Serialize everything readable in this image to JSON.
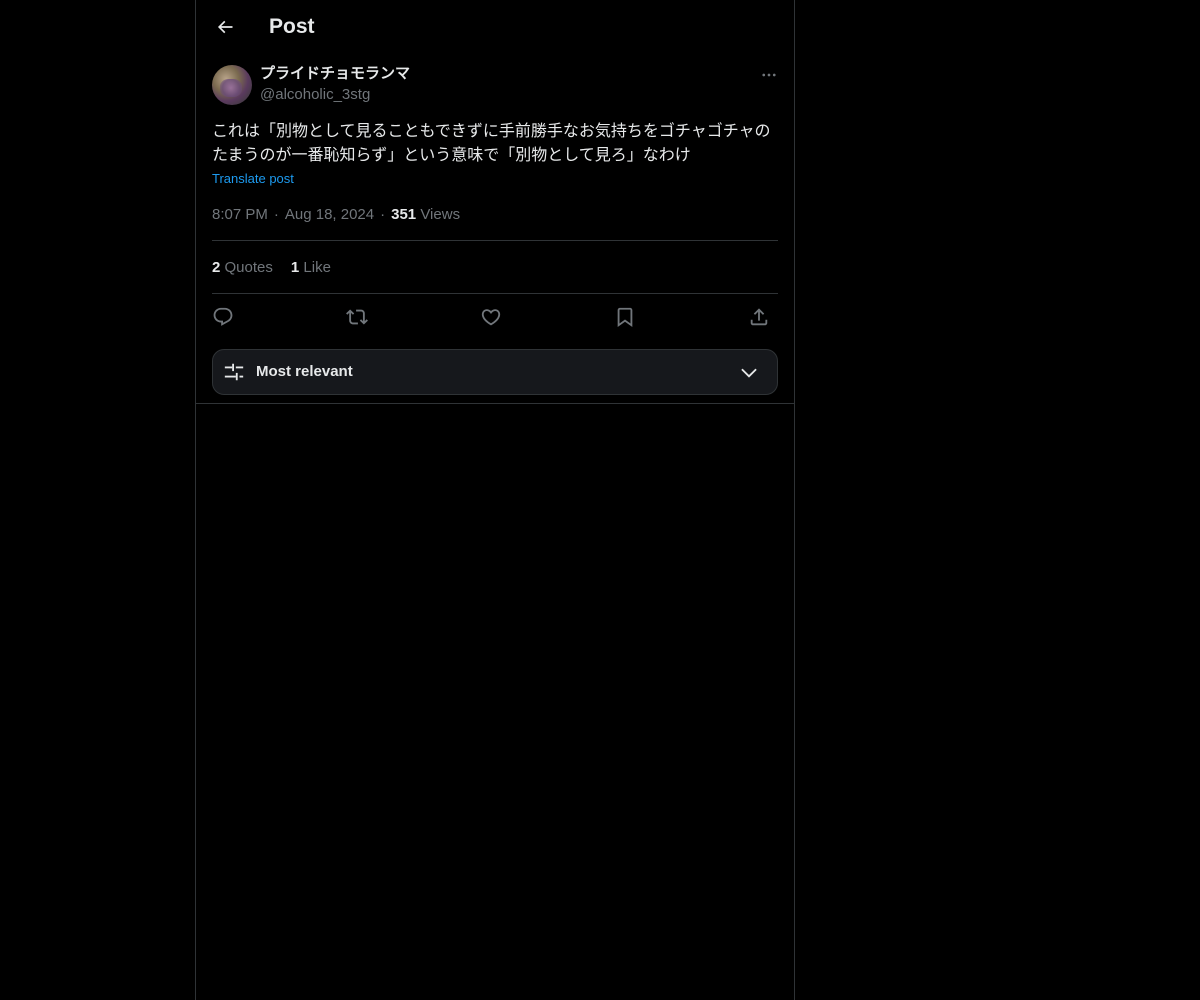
{
  "header": {
    "title": "Post",
    "back_icon": "arrow-left-icon"
  },
  "post": {
    "author": {
      "display_name": "プライドチョモランマ",
      "handle": "@alcoholic_3stg"
    },
    "text": "これは「別物として見ることもできずに手前勝手なお気持ちをゴチャゴチャのたまうのが一番恥知らず」という意味で「別物として見ろ」なわけ",
    "translate_label": "Translate post",
    "time": "8:07 PM",
    "date": "Aug 18, 2024",
    "separator": "·",
    "views_count": "351",
    "views_label": "Views",
    "quotes_count": "2",
    "quotes_label": "Quotes",
    "likes_count": "1",
    "likes_label": "Like"
  },
  "actions": {
    "icons": [
      "reply-icon",
      "repost-icon",
      "like-icon",
      "bookmark-icon",
      "share-icon"
    ]
  },
  "sort": {
    "label": "Most relevant",
    "icon": "sliders-icon",
    "dropdown_icon": "chevron-down-icon"
  },
  "colors": {
    "background": "#000000",
    "text_primary": "#e7e9ea",
    "text_secondary": "#71767b",
    "accent": "#1d9bf0",
    "border": "#2f3336"
  }
}
